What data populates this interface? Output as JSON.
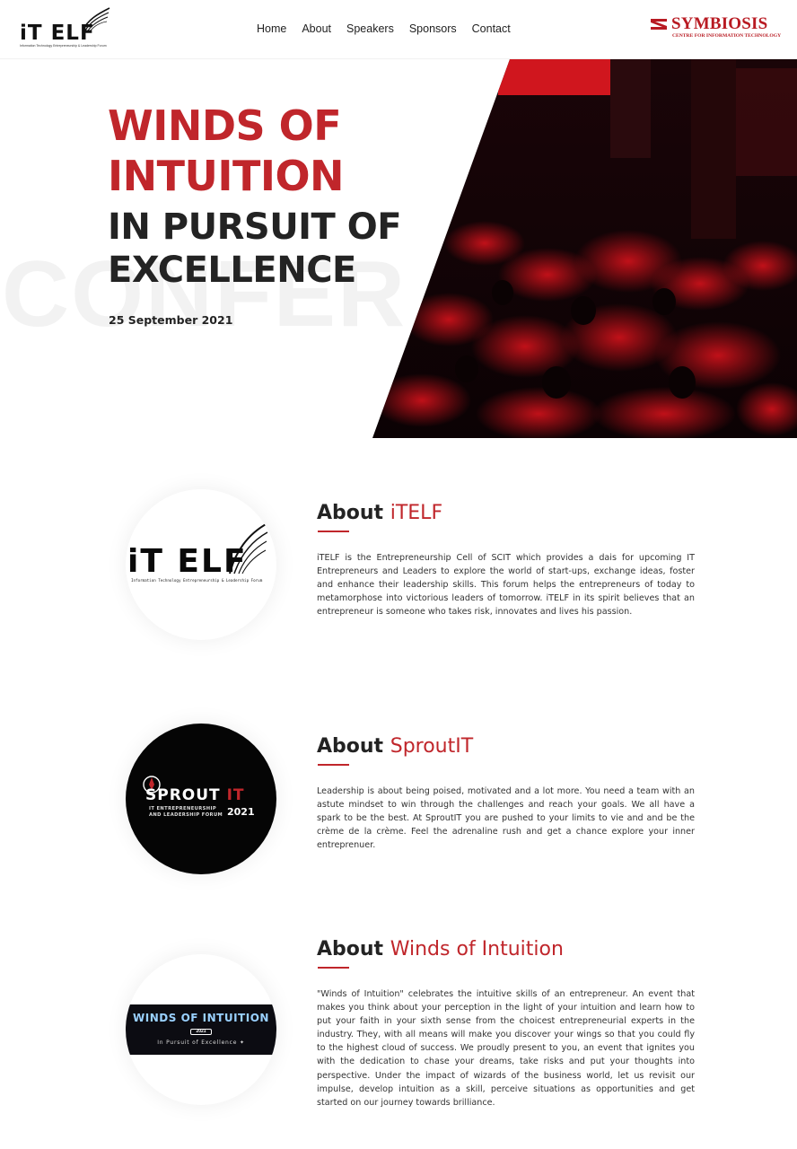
{
  "header": {
    "brand": {
      "name": "iT ELF",
      "tagline": "Information Technology Entrepreneurship & Leadership Forum"
    },
    "nav": [
      "Home",
      "About",
      "Speakers",
      "Sponsors",
      "Contact"
    ],
    "partner": {
      "name": "SYMBIOSIS",
      "subtitle": "CENTRE FOR INFORMATION TECHNOLOGY"
    }
  },
  "hero": {
    "watermark": "CONFER",
    "title_line1": "WINDS OF",
    "title_line2": "INTUITION",
    "subtitle_line1": "IN PURSUIT OF",
    "subtitle_line2": "EXCELLENCE",
    "date": "25 September 2021"
  },
  "about_itelf": {
    "title_prefix": "About ",
    "title_accent": "iTELF",
    "logo_text": "iT ELF",
    "logo_sub": "Information Technology Entrepreneurship & Leadership Forum",
    "body": "iTELF is the Entrepreneurship Cell of SCIT which provides a dais for upcoming IT Entrepreneurs and Leaders to explore the world of start-ups, exchange ideas, foster and enhance their leadership skills. This forum helps the entrepreneurs of today to metamorphose into victorious leaders of tomorrow. iTELF in its spirit believes that an entrepreneur is someone who takes risk, innovates and lives his passion."
  },
  "about_sproutit": {
    "title_prefix": "About ",
    "title_accent": "SproutIT",
    "logo_word": "SPROUT",
    "logo_word_accent": "IT",
    "logo_sub_line1": "IT ENTREPRENEURSHIP",
    "logo_sub_line2": "AND LEADERSHIP FORUM",
    "logo_year": "2021",
    "body": "Leadership is about being poised, motivated and a lot more. You need a team with an astute mindset to win through the challenges and reach your goals. We all have a spark to be the best. At SproutIT you are pushed to your limits to vie and and be the crème de la crème. Feel the adrenaline rush and get a chance explore your inner entreprenuer."
  },
  "about_woi": {
    "title_prefix": "About ",
    "title_accent": "Winds of Intuition",
    "logo_title": "WINDS OF INTUITION",
    "logo_year": "2021",
    "logo_tag": "In Pursuit of Excellence ✦",
    "body": "\"Winds of Intuition\" celebrates the intuitive skills of an entrepreneur. An event that makes you think about your perception in the light of your intuition and learn how to put your faith in your sixth sense from the choicest entrepreneurial experts in the industry. They, with all means will make you discover your wings so that you could fly to the highest cloud of success. We proudly present to you, an event that ignites you with the dedication to chase your dreams, take risks and put your thoughts into perspective. Under the impact of wizards of the business world, let us revisit our impulse, develop intuition as a skill, perceive situations as opportunities and get started on our journey towards brilliance."
  },
  "colors": {
    "accent": "#c0262b",
    "dark": "#232323"
  }
}
